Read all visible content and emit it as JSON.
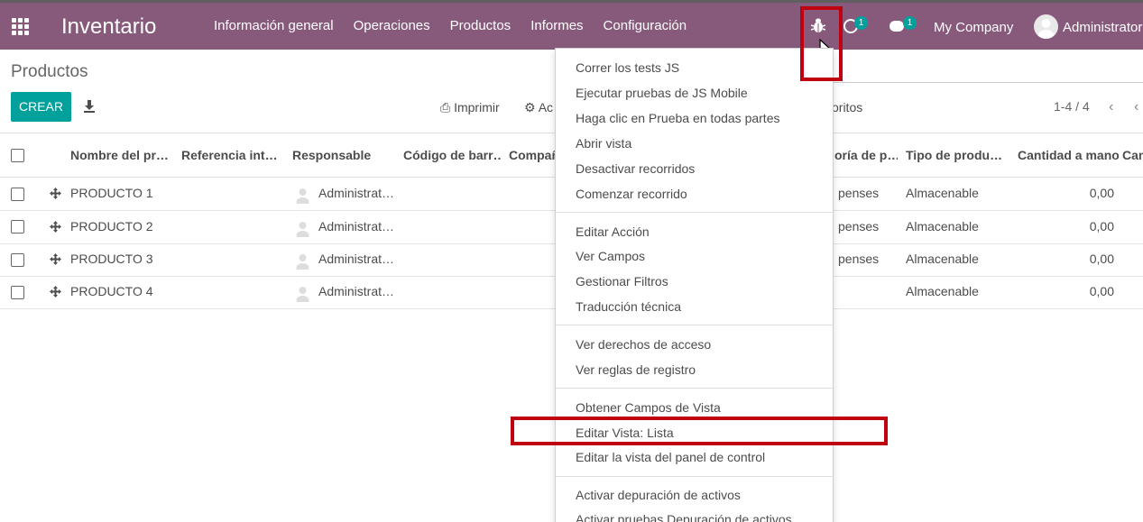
{
  "navbar": {
    "brand": "Inventario",
    "menu": [
      "Información general",
      "Operaciones",
      "Productos",
      "Informes",
      "Configuración"
    ],
    "activity_count": "1",
    "message_count": "1",
    "company": "My Company",
    "user": "Administrator"
  },
  "control_panel": {
    "breadcrumb": "Productos",
    "create_label": "CREAR",
    "print_label": "Imprimir",
    "action_label": "Ac",
    "favorites_label": "oritos",
    "pager": "1-4 / 4"
  },
  "table": {
    "headers": [
      "Nombre del pr…",
      "Referencia int…",
      "Responsable",
      "Código de barr…",
      "Compañ",
      "oría de p…",
      "Tipo de produ…",
      "Cantidad a mano",
      "Can"
    ],
    "rows": [
      {
        "name": "PRODUCTO 1",
        "responsible": "Administrat…",
        "category": "penses",
        "type": "Almacenable",
        "qty": "0,00"
      },
      {
        "name": "PRODUCTO 2",
        "responsible": "Administrat…",
        "category": "penses",
        "type": "Almacenable",
        "qty": "0,00"
      },
      {
        "name": "PRODUCTO 3",
        "responsible": "Administrat…",
        "category": "penses",
        "type": "Almacenable",
        "qty": "0,00"
      },
      {
        "name": "PRODUCTO 4",
        "responsible": "Administrat…",
        "category": "",
        "type": "Almacenable",
        "qty": "0,00"
      }
    ]
  },
  "debug_menu": {
    "items": [
      "Correr los tests JS",
      "Ejecutar pruebas de JS Mobile",
      "Haga clic en Prueba en todas partes",
      "Abrir vista",
      "Desactivar recorridos",
      "Comenzar recorrido",
      "Editar Acción",
      "Ver Campos",
      "Gestionar Filtros",
      "Traducción técnica",
      "Ver derechos de acceso",
      "Ver reglas de registro",
      "Obtener Campos de Vista",
      "Editar Vista: Lista",
      "Editar la vista del panel de control",
      "Activar depuración de activos",
      "Activar pruebas Depuración de activos"
    ]
  },
  "colors": {
    "navbar": "#875a7b",
    "primary_button": "#00a09d",
    "highlight": "#c00010"
  }
}
